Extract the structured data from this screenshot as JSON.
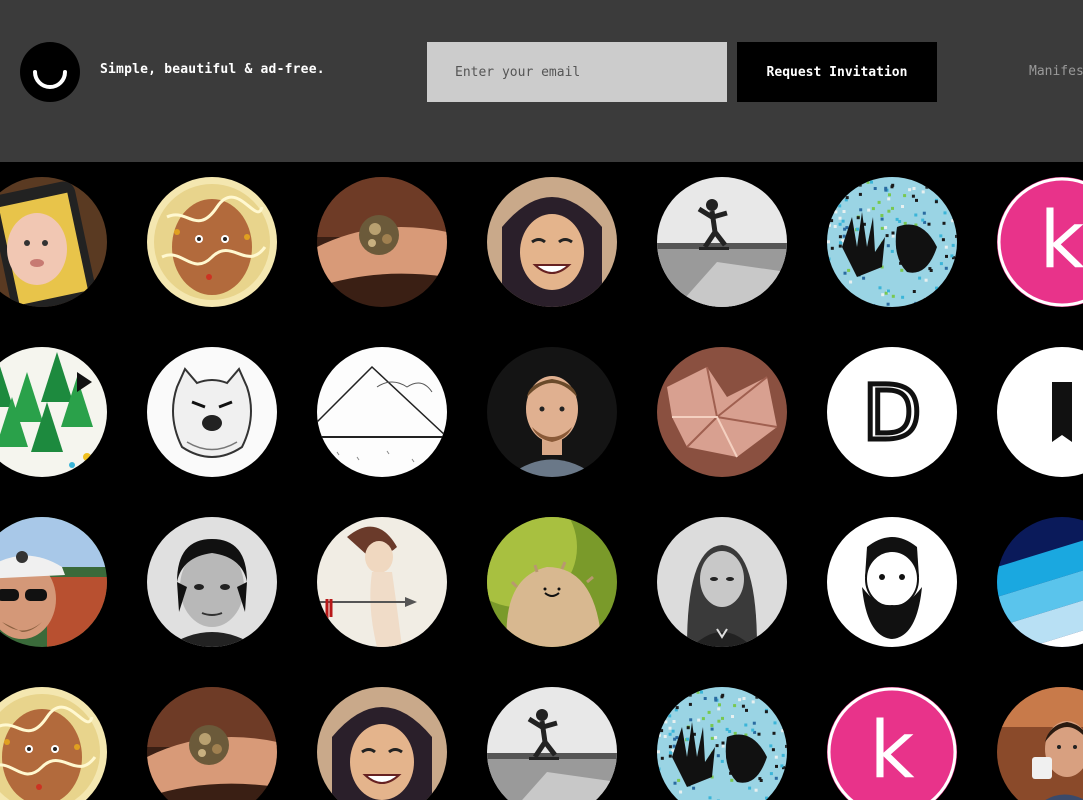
{
  "header": {
    "tagline": "Simple, beautiful & ad-free.",
    "email_placeholder": "Enter your email",
    "request_button_label": "Request Invitation",
    "nav_link_label": "Manifesto",
    "logo_icon": "smiley-icon",
    "colors": {
      "header_bg": "#3b3b3b",
      "input_bg": "#cccccc",
      "button_bg": "#000000",
      "text": "#ffffff"
    }
  },
  "avatars": [
    {
      "kind": "baby-on-phone",
      "name": "avatar-baby-phone"
    },
    {
      "kind": "face-wires",
      "name": "avatar-face-wires"
    },
    {
      "kind": "ring-hand",
      "name": "avatar-ring-hand"
    },
    {
      "kind": "hooded-smile",
      "name": "avatar-hooded-smile"
    },
    {
      "kind": "skater-bw",
      "name": "avatar-skater"
    },
    {
      "kind": "splatter-hand",
      "name": "avatar-splatter-hand"
    },
    {
      "kind": "k-logo",
      "name": "avatar-k-logo",
      "letter": "k"
    },
    {
      "kind": "trees",
      "name": "avatar-trees"
    },
    {
      "kind": "sketch-bear",
      "name": "avatar-sketch-bear"
    },
    {
      "kind": "line-drawing",
      "name": "avatar-line-drawing"
    },
    {
      "kind": "man-portrait",
      "name": "avatar-man-portrait"
    },
    {
      "kind": "crumpled-paper",
      "name": "avatar-crumpled-paper"
    },
    {
      "kind": "d-logo",
      "name": "avatar-d-logo",
      "letter": "D"
    },
    {
      "kind": "bookmark-logo",
      "name": "avatar-bookmark-logo"
    },
    {
      "kind": "cap-sunglasses",
      "name": "avatar-cap-sunglasses"
    },
    {
      "kind": "bw-portrait",
      "name": "avatar-bw-portrait"
    },
    {
      "kind": "illustration-figure",
      "name": "avatar-illustration-figure"
    },
    {
      "kind": "furry-creature",
      "name": "avatar-furry-creature"
    },
    {
      "kind": "bw-woman",
      "name": "avatar-bw-woman"
    },
    {
      "kind": "bearded-drawing",
      "name": "avatar-bearded-drawing"
    },
    {
      "kind": "blue-stripes",
      "name": "avatar-blue-stripes"
    },
    {
      "kind": "face-wires",
      "name": "avatar-face-wires-2"
    },
    {
      "kind": "ring-hand",
      "name": "avatar-ring-hand-2"
    },
    {
      "kind": "hooded-smile",
      "name": "avatar-hooded-smile-2"
    },
    {
      "kind": "skater-bw",
      "name": "avatar-skater-2"
    },
    {
      "kind": "splatter-hand",
      "name": "avatar-splatter-hand-2"
    },
    {
      "kind": "k-logo",
      "name": "avatar-k-logo-2",
      "letter": "k"
    },
    {
      "kind": "man-coffee",
      "name": "avatar-man-coffee"
    }
  ]
}
